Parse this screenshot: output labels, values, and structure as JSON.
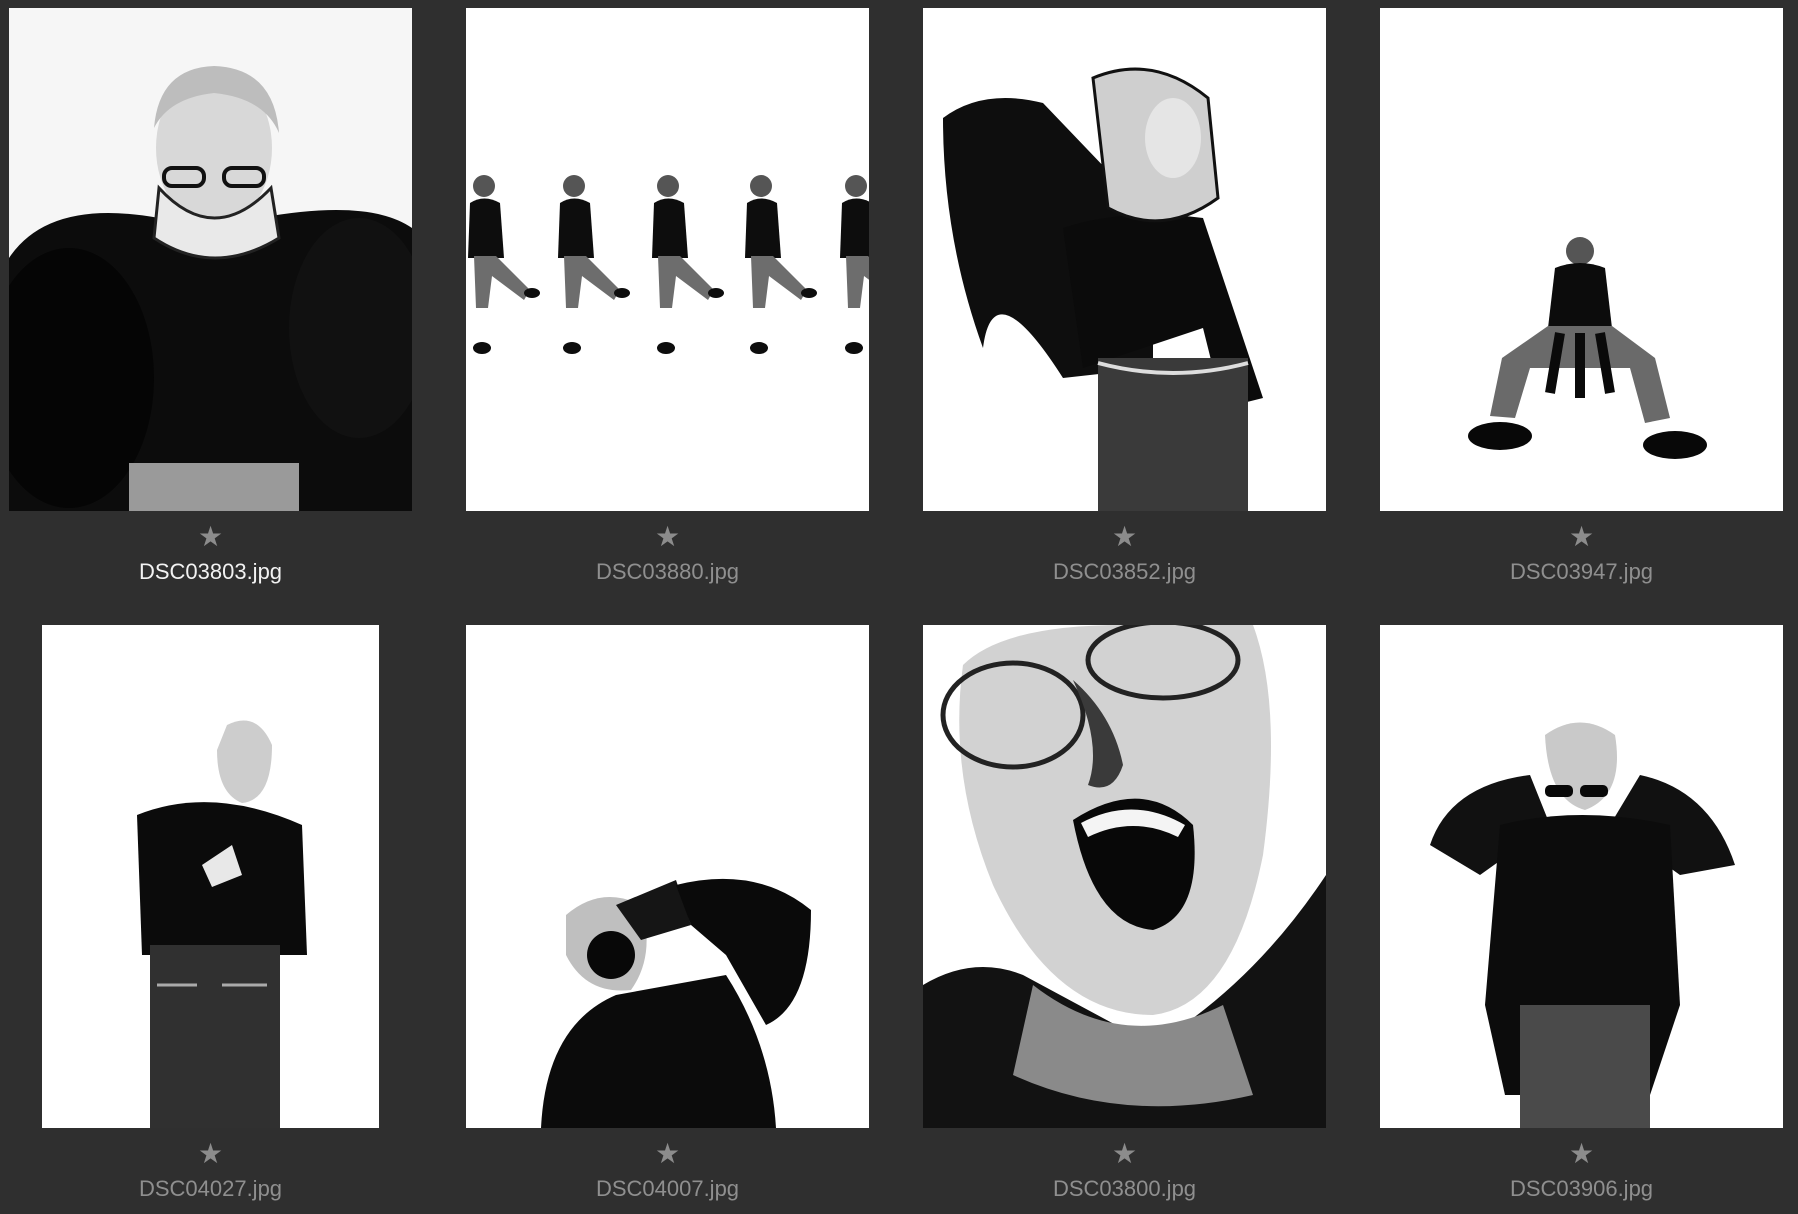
{
  "grid": {
    "items": [
      {
        "filename": "DSC03803.jpg",
        "star": "★",
        "selected": true
      },
      {
        "filename": "DSC03880.jpg",
        "star": "★",
        "selected": false
      },
      {
        "filename": "DSC03852.jpg",
        "star": "★",
        "selected": false
      },
      {
        "filename": "DSC03947.jpg",
        "star": "★",
        "selected": false
      },
      {
        "filename": "DSC04027.jpg",
        "star": "★",
        "selected": false
      },
      {
        "filename": "DSC04007.jpg",
        "star": "★",
        "selected": false
      },
      {
        "filename": "DSC03800.jpg",
        "star": "★",
        "selected": false
      },
      {
        "filename": "DSC03906.jpg",
        "star": "★",
        "selected": false
      }
    ]
  },
  "colors": {
    "background": "#2f2f2f",
    "selected_label": "#f2f2f2",
    "label": "#8f8f8f",
    "star": "#8c8c8c"
  },
  "icons": {
    "rating": "star-icon"
  }
}
